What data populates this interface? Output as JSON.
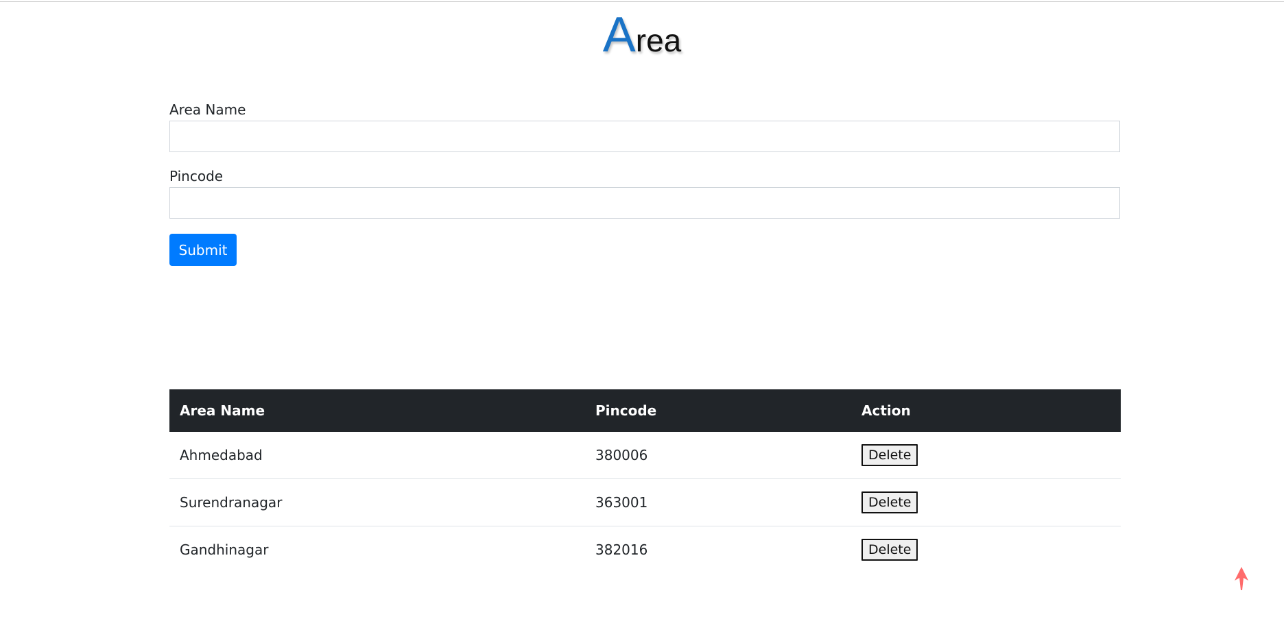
{
  "page": {
    "title_first_letter": "A",
    "title_rest": "rea"
  },
  "form": {
    "area_name_label": "Area Name",
    "area_name_value": "",
    "pincode_label": "Pincode",
    "pincode_value": "",
    "submit_label": "Submit"
  },
  "table": {
    "headers": [
      "Area Name",
      "Pincode",
      "Action"
    ],
    "rows": [
      {
        "area": "Ahmedabad",
        "pincode": "380006",
        "action": "Delete"
      },
      {
        "area": "Surendranagar",
        "pincode": "363001",
        "action": "Delete"
      },
      {
        "area": "Gandhinagar",
        "pincode": "382016",
        "action": "Delete"
      }
    ]
  },
  "colors": {
    "accent": "#007bff",
    "title_letter": "#1a73c6",
    "header_bg": "#212529",
    "scroll_icon": "#ff6b6b"
  },
  "icons": {
    "scroll_top": "arrow-up-icon"
  }
}
